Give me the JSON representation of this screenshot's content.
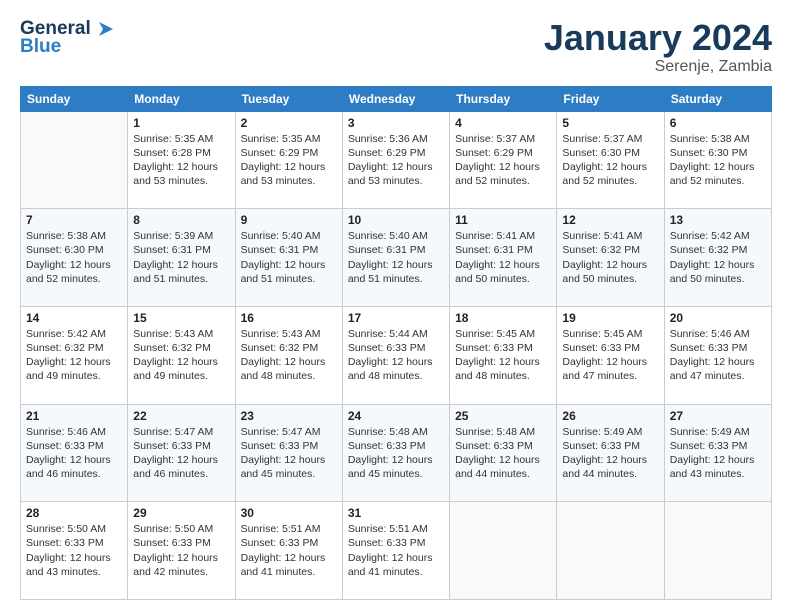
{
  "header": {
    "logo_line1": "General",
    "logo_line2": "Blue",
    "title": "January 2024",
    "subtitle": "Serenje, Zambia"
  },
  "weekdays": [
    "Sunday",
    "Monday",
    "Tuesday",
    "Wednesday",
    "Thursday",
    "Friday",
    "Saturday"
  ],
  "weeks": [
    [
      {
        "day": "",
        "sunrise": "",
        "sunset": "",
        "daylight": ""
      },
      {
        "day": "1",
        "sunrise": "Sunrise: 5:35 AM",
        "sunset": "Sunset: 6:28 PM",
        "daylight": "Daylight: 12 hours and 53 minutes."
      },
      {
        "day": "2",
        "sunrise": "Sunrise: 5:35 AM",
        "sunset": "Sunset: 6:29 PM",
        "daylight": "Daylight: 12 hours and 53 minutes."
      },
      {
        "day": "3",
        "sunrise": "Sunrise: 5:36 AM",
        "sunset": "Sunset: 6:29 PM",
        "daylight": "Daylight: 12 hours and 53 minutes."
      },
      {
        "day": "4",
        "sunrise": "Sunrise: 5:37 AM",
        "sunset": "Sunset: 6:29 PM",
        "daylight": "Daylight: 12 hours and 52 minutes."
      },
      {
        "day": "5",
        "sunrise": "Sunrise: 5:37 AM",
        "sunset": "Sunset: 6:30 PM",
        "daylight": "Daylight: 12 hours and 52 minutes."
      },
      {
        "day": "6",
        "sunrise": "Sunrise: 5:38 AM",
        "sunset": "Sunset: 6:30 PM",
        "daylight": "Daylight: 12 hours and 52 minutes."
      }
    ],
    [
      {
        "day": "7",
        "sunrise": "Sunrise: 5:38 AM",
        "sunset": "Sunset: 6:30 PM",
        "daylight": "Daylight: 12 hours and 52 minutes."
      },
      {
        "day": "8",
        "sunrise": "Sunrise: 5:39 AM",
        "sunset": "Sunset: 6:31 PM",
        "daylight": "Daylight: 12 hours and 51 minutes."
      },
      {
        "day": "9",
        "sunrise": "Sunrise: 5:40 AM",
        "sunset": "Sunset: 6:31 PM",
        "daylight": "Daylight: 12 hours and 51 minutes."
      },
      {
        "day": "10",
        "sunrise": "Sunrise: 5:40 AM",
        "sunset": "Sunset: 6:31 PM",
        "daylight": "Daylight: 12 hours and 51 minutes."
      },
      {
        "day": "11",
        "sunrise": "Sunrise: 5:41 AM",
        "sunset": "Sunset: 6:31 PM",
        "daylight": "Daylight: 12 hours and 50 minutes."
      },
      {
        "day": "12",
        "sunrise": "Sunrise: 5:41 AM",
        "sunset": "Sunset: 6:32 PM",
        "daylight": "Daylight: 12 hours and 50 minutes."
      },
      {
        "day": "13",
        "sunrise": "Sunrise: 5:42 AM",
        "sunset": "Sunset: 6:32 PM",
        "daylight": "Daylight: 12 hours and 50 minutes."
      }
    ],
    [
      {
        "day": "14",
        "sunrise": "Sunrise: 5:42 AM",
        "sunset": "Sunset: 6:32 PM",
        "daylight": "Daylight: 12 hours and 49 minutes."
      },
      {
        "day": "15",
        "sunrise": "Sunrise: 5:43 AM",
        "sunset": "Sunset: 6:32 PM",
        "daylight": "Daylight: 12 hours and 49 minutes."
      },
      {
        "day": "16",
        "sunrise": "Sunrise: 5:43 AM",
        "sunset": "Sunset: 6:32 PM",
        "daylight": "Daylight: 12 hours and 48 minutes."
      },
      {
        "day": "17",
        "sunrise": "Sunrise: 5:44 AM",
        "sunset": "Sunset: 6:33 PM",
        "daylight": "Daylight: 12 hours and 48 minutes."
      },
      {
        "day": "18",
        "sunrise": "Sunrise: 5:45 AM",
        "sunset": "Sunset: 6:33 PM",
        "daylight": "Daylight: 12 hours and 48 minutes."
      },
      {
        "day": "19",
        "sunrise": "Sunrise: 5:45 AM",
        "sunset": "Sunset: 6:33 PM",
        "daylight": "Daylight: 12 hours and 47 minutes."
      },
      {
        "day": "20",
        "sunrise": "Sunrise: 5:46 AM",
        "sunset": "Sunset: 6:33 PM",
        "daylight": "Daylight: 12 hours and 47 minutes."
      }
    ],
    [
      {
        "day": "21",
        "sunrise": "Sunrise: 5:46 AM",
        "sunset": "Sunset: 6:33 PM",
        "daylight": "Daylight: 12 hours and 46 minutes."
      },
      {
        "day": "22",
        "sunrise": "Sunrise: 5:47 AM",
        "sunset": "Sunset: 6:33 PM",
        "daylight": "Daylight: 12 hours and 46 minutes."
      },
      {
        "day": "23",
        "sunrise": "Sunrise: 5:47 AM",
        "sunset": "Sunset: 6:33 PM",
        "daylight": "Daylight: 12 hours and 45 minutes."
      },
      {
        "day": "24",
        "sunrise": "Sunrise: 5:48 AM",
        "sunset": "Sunset: 6:33 PM",
        "daylight": "Daylight: 12 hours and 45 minutes."
      },
      {
        "day": "25",
        "sunrise": "Sunrise: 5:48 AM",
        "sunset": "Sunset: 6:33 PM",
        "daylight": "Daylight: 12 hours and 44 minutes."
      },
      {
        "day": "26",
        "sunrise": "Sunrise: 5:49 AM",
        "sunset": "Sunset: 6:33 PM",
        "daylight": "Daylight: 12 hours and 44 minutes."
      },
      {
        "day": "27",
        "sunrise": "Sunrise: 5:49 AM",
        "sunset": "Sunset: 6:33 PM",
        "daylight": "Daylight: 12 hours and 43 minutes."
      }
    ],
    [
      {
        "day": "28",
        "sunrise": "Sunrise: 5:50 AM",
        "sunset": "Sunset: 6:33 PM",
        "daylight": "Daylight: 12 hours and 43 minutes."
      },
      {
        "day": "29",
        "sunrise": "Sunrise: 5:50 AM",
        "sunset": "Sunset: 6:33 PM",
        "daylight": "Daylight: 12 hours and 42 minutes."
      },
      {
        "day": "30",
        "sunrise": "Sunrise: 5:51 AM",
        "sunset": "Sunset: 6:33 PM",
        "daylight": "Daylight: 12 hours and 41 minutes."
      },
      {
        "day": "31",
        "sunrise": "Sunrise: 5:51 AM",
        "sunset": "Sunset: 6:33 PM",
        "daylight": "Daylight: 12 hours and 41 minutes."
      },
      {
        "day": "",
        "sunrise": "",
        "sunset": "",
        "daylight": ""
      },
      {
        "day": "",
        "sunrise": "",
        "sunset": "",
        "daylight": ""
      },
      {
        "day": "",
        "sunrise": "",
        "sunset": "",
        "daylight": ""
      }
    ]
  ]
}
